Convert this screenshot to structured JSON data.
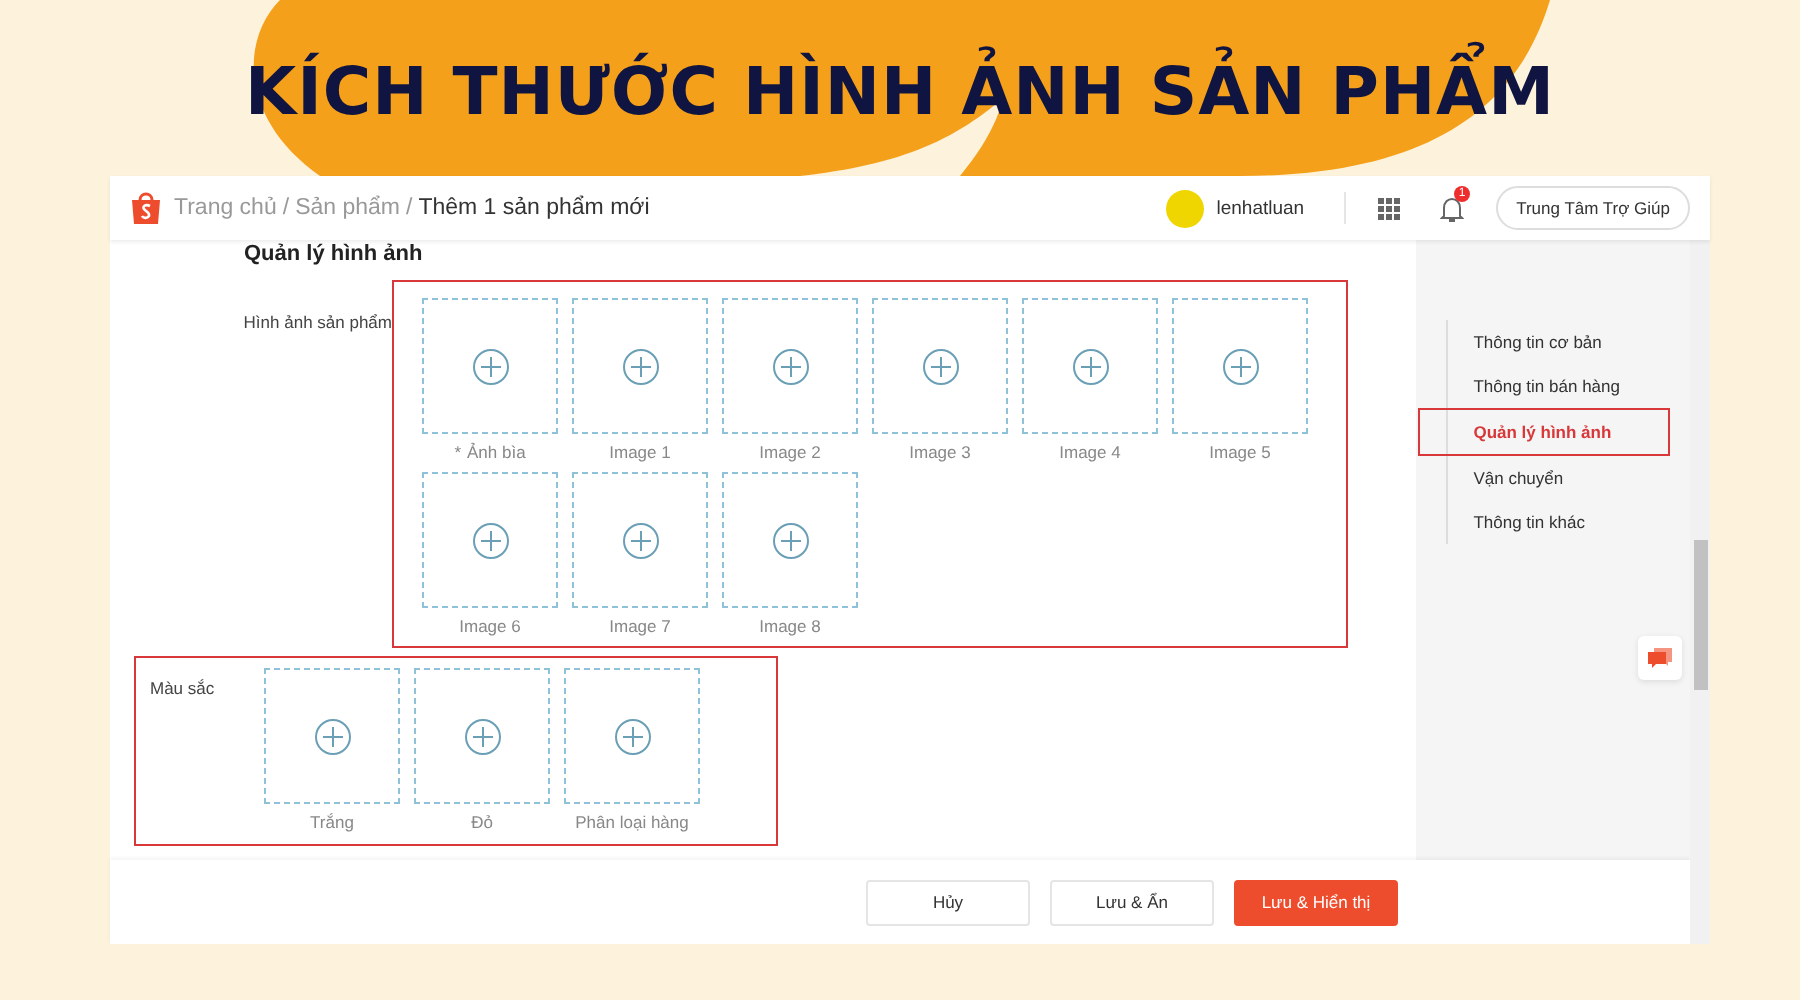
{
  "banner": {
    "title": "KÍCH THƯỚC HÌNH ẢNH SẢN PHẨM"
  },
  "header": {
    "breadcrumb": [
      {
        "label": "Trang chủ",
        "current": false
      },
      {
        "label": "Sản phẩm",
        "current": false
      },
      {
        "label": "Thêm 1 sản phẩm mới",
        "current": true
      }
    ],
    "separator": "/",
    "username": "lenhatluan",
    "notification_count": "1",
    "help_button": "Trung Tâm Trợ Giúp"
  },
  "section_title": "Quản lý hình ảnh",
  "groups": [
    {
      "label": "Hình ảnh sản phẩm",
      "kind": "framed_tiles",
      "tiles": [
        {
          "label": "Ảnh bìa",
          "required": true
        },
        {
          "label": "Image 1",
          "required": false
        },
        {
          "label": "Image 2",
          "required": false
        },
        {
          "label": "Image 3",
          "required": false
        },
        {
          "label": "Image 4",
          "required": false
        },
        {
          "label": "Image 5",
          "required": false
        },
        {
          "label": "Image 6",
          "required": false
        },
        {
          "label": "Image 7",
          "required": false
        },
        {
          "label": "Image 8",
          "required": false
        }
      ]
    },
    {
      "label": "Màu sắc",
      "kind": "framed_row",
      "tiles": [
        {
          "label": "Trắng",
          "required": false
        },
        {
          "label": "Đỏ",
          "required": false
        },
        {
          "label": "Phân loại hàng",
          "required": false
        }
      ]
    }
  ],
  "required_mark": "*",
  "sidebar": {
    "items": [
      {
        "label": "Thông tin cơ bản",
        "selected": false
      },
      {
        "label": "Thông tin bán hàng",
        "selected": false
      },
      {
        "label": "Quản lý hình ảnh",
        "selected": true
      },
      {
        "label": "Vận chuyển",
        "selected": false
      },
      {
        "label": "Thông tin khác",
        "selected": false
      }
    ]
  },
  "footer": {
    "buttons": [
      {
        "label": "Hủy",
        "kind": "secondary"
      },
      {
        "label": "Lưu & Ẩn",
        "kind": "secondary"
      },
      {
        "label": "Lưu & Hiển thị",
        "kind": "primary"
      }
    ]
  }
}
